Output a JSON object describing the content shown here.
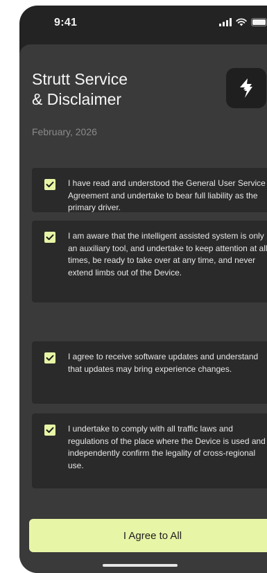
{
  "status_bar": {
    "time": "9:41",
    "icons": [
      "signal-icon",
      "wifi-icon",
      "battery-icon"
    ]
  },
  "header": {
    "title_line1": "Strutt Service",
    "title_line2": "& Disclaimer",
    "date": "February, 2026",
    "app_icon": "lightning-logo-icon"
  },
  "agreements": [
    {
      "checked": true,
      "text": "I have read and understood the General User Service Agreement and undertake to bear full liability as the primary driver."
    },
    {
      "checked": true,
      "text": "I am aware that the intelligent assisted system is only an auxiliary tool, and undertake to keep attention at all times, be ready to take over at any time, and never extend limbs out of the Device."
    },
    {
      "checked": true,
      "text": "I agree to receive software updates and understand that updates may bring experience changes."
    },
    {
      "checked": true,
      "text": "I undertake to comply with all traffic laws and regulations of the place where the Device is used and independently confirm the legality of cross-regional use."
    }
  ],
  "footer": {
    "agree_all_label": "I Agree to All"
  },
  "colors": {
    "accent": "#E7F5A6",
    "sheet_background": "#3A3A3A",
    "card_background": "#2A2A2A"
  }
}
